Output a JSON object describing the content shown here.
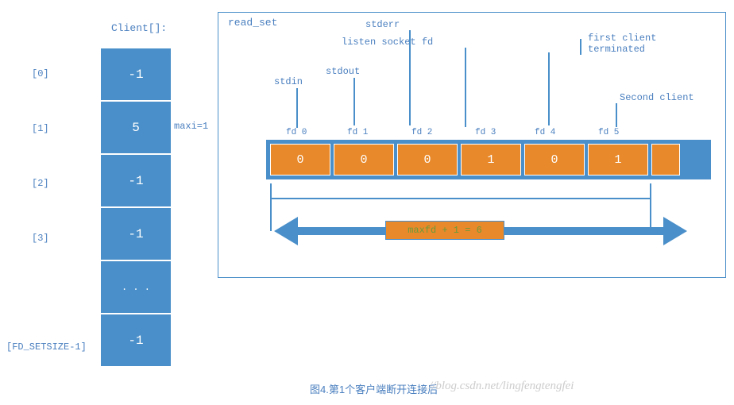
{
  "client_title": "Client[]:",
  "client_indices": [
    "[0]",
    "[1]",
    "[2]",
    "[3]",
    "",
    "[FD_SETSIZE-1]"
  ],
  "client_values": [
    "-1",
    "5",
    "-1",
    "-1",
    ". . .",
    "-1"
  ],
  "maxi_label": "maxi=1",
  "readset_title": "read_set",
  "fd_labels": {
    "stdin": "stdin",
    "stdout": "stdout",
    "stderr": "stderr",
    "listen": "listen socket fd",
    "first_client": "first client\nterminated",
    "second_client": "Second client"
  },
  "fd_indices": [
    "fd 0",
    "fd 1",
    "fd 2",
    "fd 3",
    "fd 4",
    "fd 5"
  ],
  "fd_values": [
    "0",
    "0",
    "0",
    "1",
    "0",
    "1"
  ],
  "maxfd_label": "maxfd + 1 = 6",
  "caption": "图4.第1个客户端断开连接后",
  "watermark": "//blog.csdn.net/lingfengtengfei",
  "chart_data": {
    "type": "table",
    "title": "Client array and read_set fd_set state after first client terminated",
    "client_array": {
      "indices": [
        0,
        1,
        2,
        3,
        "...",
        "FD_SETSIZE-1"
      ],
      "values": [
        -1,
        5,
        -1,
        -1,
        "...",
        -1
      ],
      "maxi": 1
    },
    "read_set": {
      "fd": [
        0,
        1,
        2,
        3,
        4,
        5
      ],
      "bit": [
        0,
        0,
        0,
        1,
        0,
        1
      ],
      "labels": [
        "stdin",
        "stdout",
        "stderr",
        "listen socket fd",
        "first client terminated",
        "Second client"
      ]
    },
    "maxfd_plus_1": 6
  }
}
